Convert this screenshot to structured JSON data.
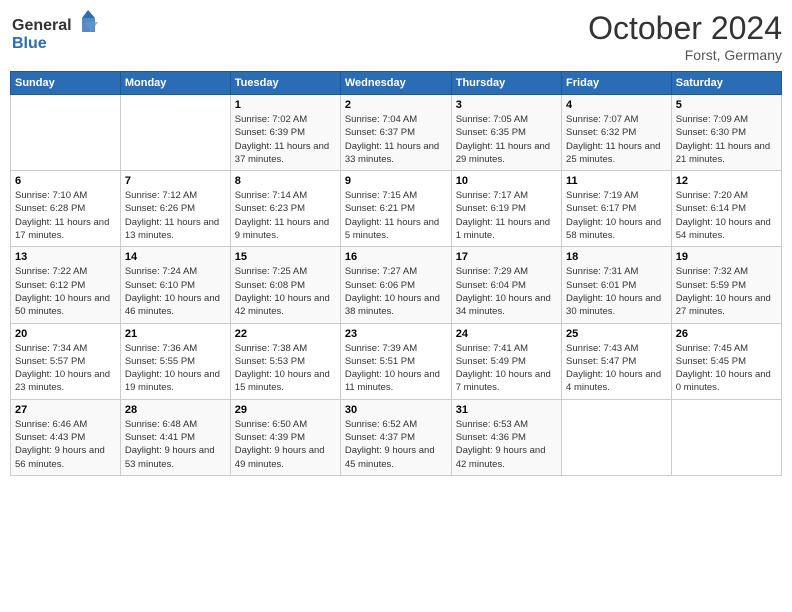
{
  "header": {
    "logo_text_general": "General",
    "logo_text_blue": "Blue",
    "month_title": "October 2024",
    "subtitle": "Forst, Germany"
  },
  "days_of_week": [
    "Sunday",
    "Monday",
    "Tuesday",
    "Wednesday",
    "Thursday",
    "Friday",
    "Saturday"
  ],
  "weeks": [
    [
      {
        "day": "",
        "info": ""
      },
      {
        "day": "",
        "info": ""
      },
      {
        "day": "1",
        "info": "Sunrise: 7:02 AM\nSunset: 6:39 PM\nDaylight: 11 hours and 37 minutes."
      },
      {
        "day": "2",
        "info": "Sunrise: 7:04 AM\nSunset: 6:37 PM\nDaylight: 11 hours and 33 minutes."
      },
      {
        "day": "3",
        "info": "Sunrise: 7:05 AM\nSunset: 6:35 PM\nDaylight: 11 hours and 29 minutes."
      },
      {
        "day": "4",
        "info": "Sunrise: 7:07 AM\nSunset: 6:32 PM\nDaylight: 11 hours and 25 minutes."
      },
      {
        "day": "5",
        "info": "Sunrise: 7:09 AM\nSunset: 6:30 PM\nDaylight: 11 hours and 21 minutes."
      }
    ],
    [
      {
        "day": "6",
        "info": "Sunrise: 7:10 AM\nSunset: 6:28 PM\nDaylight: 11 hours and 17 minutes."
      },
      {
        "day": "7",
        "info": "Sunrise: 7:12 AM\nSunset: 6:26 PM\nDaylight: 11 hours and 13 minutes."
      },
      {
        "day": "8",
        "info": "Sunrise: 7:14 AM\nSunset: 6:23 PM\nDaylight: 11 hours and 9 minutes."
      },
      {
        "day": "9",
        "info": "Sunrise: 7:15 AM\nSunset: 6:21 PM\nDaylight: 11 hours and 5 minutes."
      },
      {
        "day": "10",
        "info": "Sunrise: 7:17 AM\nSunset: 6:19 PM\nDaylight: 11 hours and 1 minute."
      },
      {
        "day": "11",
        "info": "Sunrise: 7:19 AM\nSunset: 6:17 PM\nDaylight: 10 hours and 58 minutes."
      },
      {
        "day": "12",
        "info": "Sunrise: 7:20 AM\nSunset: 6:14 PM\nDaylight: 10 hours and 54 minutes."
      }
    ],
    [
      {
        "day": "13",
        "info": "Sunrise: 7:22 AM\nSunset: 6:12 PM\nDaylight: 10 hours and 50 minutes."
      },
      {
        "day": "14",
        "info": "Sunrise: 7:24 AM\nSunset: 6:10 PM\nDaylight: 10 hours and 46 minutes."
      },
      {
        "day": "15",
        "info": "Sunrise: 7:25 AM\nSunset: 6:08 PM\nDaylight: 10 hours and 42 minutes."
      },
      {
        "day": "16",
        "info": "Sunrise: 7:27 AM\nSunset: 6:06 PM\nDaylight: 10 hours and 38 minutes."
      },
      {
        "day": "17",
        "info": "Sunrise: 7:29 AM\nSunset: 6:04 PM\nDaylight: 10 hours and 34 minutes."
      },
      {
        "day": "18",
        "info": "Sunrise: 7:31 AM\nSunset: 6:01 PM\nDaylight: 10 hours and 30 minutes."
      },
      {
        "day": "19",
        "info": "Sunrise: 7:32 AM\nSunset: 5:59 PM\nDaylight: 10 hours and 27 minutes."
      }
    ],
    [
      {
        "day": "20",
        "info": "Sunrise: 7:34 AM\nSunset: 5:57 PM\nDaylight: 10 hours and 23 minutes."
      },
      {
        "day": "21",
        "info": "Sunrise: 7:36 AM\nSunset: 5:55 PM\nDaylight: 10 hours and 19 minutes."
      },
      {
        "day": "22",
        "info": "Sunrise: 7:38 AM\nSunset: 5:53 PM\nDaylight: 10 hours and 15 minutes."
      },
      {
        "day": "23",
        "info": "Sunrise: 7:39 AM\nSunset: 5:51 PM\nDaylight: 10 hours and 11 minutes."
      },
      {
        "day": "24",
        "info": "Sunrise: 7:41 AM\nSunset: 5:49 PM\nDaylight: 10 hours and 7 minutes."
      },
      {
        "day": "25",
        "info": "Sunrise: 7:43 AM\nSunset: 5:47 PM\nDaylight: 10 hours and 4 minutes."
      },
      {
        "day": "26",
        "info": "Sunrise: 7:45 AM\nSunset: 5:45 PM\nDaylight: 10 hours and 0 minutes."
      }
    ],
    [
      {
        "day": "27",
        "info": "Sunrise: 6:46 AM\nSunset: 4:43 PM\nDaylight: 9 hours and 56 minutes."
      },
      {
        "day": "28",
        "info": "Sunrise: 6:48 AM\nSunset: 4:41 PM\nDaylight: 9 hours and 53 minutes."
      },
      {
        "day": "29",
        "info": "Sunrise: 6:50 AM\nSunset: 4:39 PM\nDaylight: 9 hours and 49 minutes."
      },
      {
        "day": "30",
        "info": "Sunrise: 6:52 AM\nSunset: 4:37 PM\nDaylight: 9 hours and 45 minutes."
      },
      {
        "day": "31",
        "info": "Sunrise: 6:53 AM\nSunset: 4:36 PM\nDaylight: 9 hours and 42 minutes."
      },
      {
        "day": "",
        "info": ""
      },
      {
        "day": "",
        "info": ""
      }
    ]
  ]
}
